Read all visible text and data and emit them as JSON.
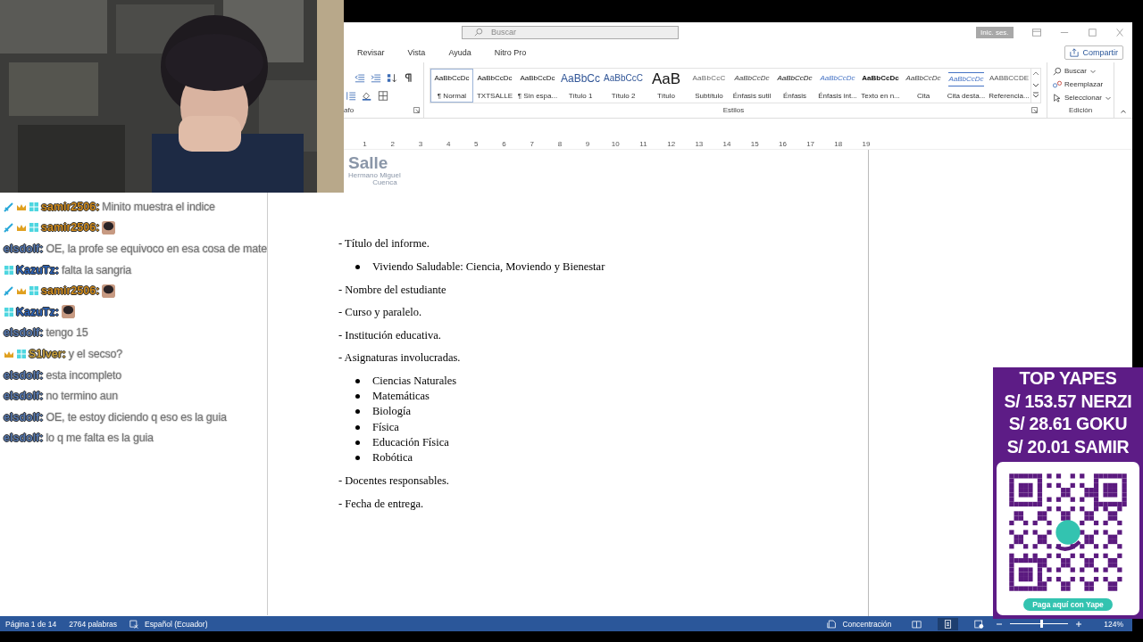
{
  "window": {
    "search": {
      "placeholder": "Buscar"
    },
    "sign_in": "Inic. ses."
  },
  "tabs": [
    {
      "label": "Revisar",
      "selected": false
    },
    {
      "label": "Vista",
      "selected": false
    },
    {
      "label": "Ayuda",
      "selected": false
    },
    {
      "label": "Nitro Pro",
      "selected": false
    }
  ],
  "share_button": "Compartir",
  "ribbon": {
    "paragraph_group": "afo",
    "styles": [
      {
        "preview": "AaBbCcDc",
        "name": "¶ Normal",
        "kind": "normal",
        "selected": true
      },
      {
        "preview": "AaBbCcDc",
        "name": "TXTSALLE",
        "kind": "normal",
        "selected": false
      },
      {
        "preview": "AaBbCcDc",
        "name": "¶ Sin espa...",
        "kind": "normal",
        "selected": false
      },
      {
        "preview": "AaBbCc",
        "name": "Título 1",
        "kind": "heading1",
        "selected": false
      },
      {
        "preview": "AaBbCcC",
        "name": "Título 2",
        "kind": "heading2",
        "selected": false
      },
      {
        "preview": "AaB",
        "name": "Título",
        "kind": "title",
        "selected": false
      },
      {
        "preview": "AaBbCcC",
        "name": "Subtítulo",
        "kind": "subtitle",
        "selected": false
      },
      {
        "preview": "AaBbCcDc",
        "name": "Énfasis sutil",
        "kind": "subtle",
        "selected": false
      },
      {
        "preview": "AaBbCcDc",
        "name": "Énfasis",
        "kind": "emphasis",
        "selected": false
      },
      {
        "preview": "AaBbCcDc",
        "name": "Énfasis int...",
        "kind": "intense",
        "selected": false
      },
      {
        "preview": "AaBbCcDc",
        "name": "Texto en n...",
        "kind": "strong",
        "selected": false
      },
      {
        "preview": "AaBbCcDc",
        "name": "Cita",
        "kind": "quote",
        "selected": false
      },
      {
        "preview": "AaBbCcDc",
        "name": "Cita desta...",
        "kind": "intensequote",
        "selected": false
      },
      {
        "preview": "AABBCCDE",
        "name": "Referencia...",
        "kind": "reference",
        "selected": false
      }
    ],
    "styles_group": "Estilos",
    "editing": [
      {
        "label": "Buscar",
        "kind": "find"
      },
      {
        "label": "Reemplazar",
        "kind": "replace"
      },
      {
        "label": "Seleccionar",
        "kind": "select"
      }
    ],
    "editing_group": "Edición"
  },
  "ruler": [
    "1",
    "2",
    "3",
    "4",
    "5",
    "6",
    "7",
    "8",
    "9",
    "10",
    "11",
    "12",
    "13",
    "14",
    "15",
    "16",
    "17",
    "18",
    "19"
  ],
  "document": {
    "logo": {
      "name": "Salle",
      "line1": "Hermano Miguel",
      "line2": "Cuenca"
    },
    "items": [
      {
        "text": "- Título del informe.",
        "children": [
          {
            "text": "Viviendo Saludable: Ciencia, Moviendo y Bienestar"
          }
        ]
      },
      {
        "text": "- Nombre del estudiante"
      },
      {
        "text": "- Curso y paralelo."
      },
      {
        "text": "- Institución educativa."
      },
      {
        "text": "- Asignaturas involucradas.",
        "children": [
          {
            "text": "Ciencias Naturales"
          },
          {
            "text": "Matemáticas"
          },
          {
            "text": "Biología"
          },
          {
            "text": "Física"
          },
          {
            "text": "Educación Física"
          },
          {
            "text": "Robótica"
          }
        ]
      },
      {
        "text": "- Docentes responsables."
      },
      {
        "text": "- Fecha de entrega."
      }
    ]
  },
  "status_bar": {
    "page": "Página 1 de 14",
    "words": "2764 palabras",
    "language": "Español (Ecuador)",
    "focus": "Concentración",
    "zoom": {
      "level": 0.54,
      "reading": "124%"
    }
  },
  "chat": [
    {
      "sword": true,
      "crown": true,
      "sub": true,
      "user": "samir2506:",
      "color": "#d08a1a",
      "text": "Minito muestra el indice"
    },
    {
      "sword": true,
      "crown": true,
      "sub": true,
      "user": "samir2506:",
      "color": "#d08a1a",
      "emote": true
    },
    {
      "sword": false,
      "crown": false,
      "sub": false,
      "user": "elsdolf:",
      "color": "#5578b0",
      "text": "OE, la profe se equivoco en esa cosa de mate"
    },
    {
      "sword": false,
      "crown": false,
      "sub": true,
      "user": "KazuTz:",
      "color": "#2a62b8",
      "text": "falta la sangria"
    },
    {
      "sword": true,
      "crown": true,
      "sub": true,
      "user": "samir2506:",
      "color": "#d08a1a",
      "emote": true
    },
    {
      "sword": false,
      "crown": false,
      "sub": true,
      "user": "KazuTz:",
      "color": "#2a62b8",
      "emote": true
    },
    {
      "sword": false,
      "crown": false,
      "sub": false,
      "user": "elsdolf:",
      "color": "#5578b0",
      "text": "tengo 15"
    },
    {
      "sword": false,
      "crown": true,
      "sub": true,
      "user": "S1lver:",
      "color": "#c9a03a",
      "text": "y el secso?"
    },
    {
      "sword": false,
      "crown": false,
      "sub": false,
      "user": "elsdolf:",
      "color": "#5578b0",
      "text": "esta incompleto"
    },
    {
      "sword": false,
      "crown": false,
      "sub": false,
      "user": "elsdolf:",
      "color": "#5578b0",
      "text": "no termino aun"
    },
    {
      "sword": false,
      "crown": false,
      "sub": false,
      "user": "elsdolf:",
      "color": "#5578b0",
      "text": "OE, te estoy diciendo q eso es la guia"
    },
    {
      "sword": false,
      "crown": false,
      "sub": false,
      "user": "elsdolf:",
      "color": "#5578b0",
      "text": "lo q me falta es la guia"
    }
  ],
  "donations": {
    "title": "TOP YAPES",
    "entries": [
      "S/ 153.57 NERZI",
      "S/ 28.61 GOKU",
      "S/ 20.01 SAMIR"
    ],
    "pay_label": "Paga aquí con Yape"
  }
}
